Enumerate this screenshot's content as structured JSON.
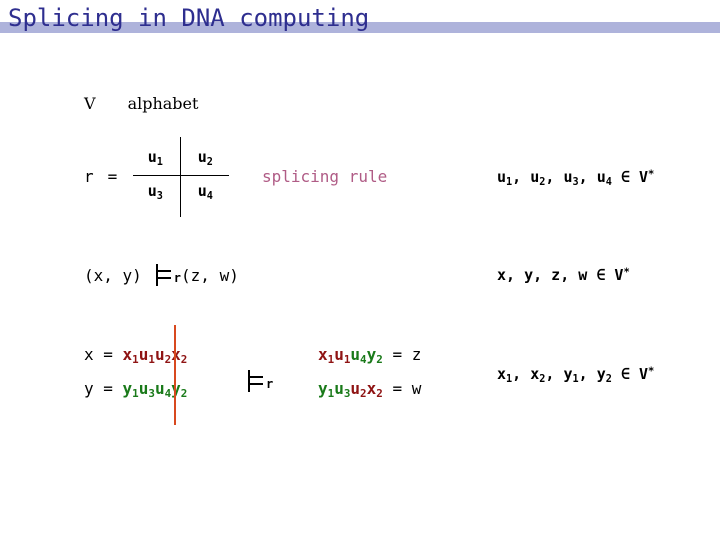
{
  "slide": {
    "title": "Splicing in DNA computing",
    "title_color": "#2e2e8f",
    "bar_color": "#aeb3db"
  },
  "alphabet_row": {
    "symbol": "V",
    "label": "alphabet"
  },
  "rule": {
    "name": "r",
    "equals": "=",
    "cells": {
      "u1": "u",
      "u1_sub": "1",
      "u2": "u",
      "u2_sub": "2",
      "u3": "u",
      "u3_sub": "3",
      "u4": "u",
      "u4_sub": "4"
    },
    "caption": "splicing rule",
    "caption_color": "#b05c86"
  },
  "notes": {
    "u_membership": {
      "text": "u",
      "s1": "1",
      "t2": ", u",
      "s2": "2",
      "t3": ", u",
      "s3": "3",
      "t4": ", u",
      "s4": "4",
      "tail": " ∈ V",
      "star": "*"
    },
    "xyzw_membership": {
      "text": "x, y, z, w ∈ V",
      "star": "*"
    },
    "x12_membership": {
      "lead": "x",
      "s1": "1",
      "p2": ", x",
      "s2": "2",
      "p3": ", y",
      "s3": "1",
      "p4": ", y",
      "s4": "2",
      "tail": " ∈ V",
      "star": "*"
    }
  },
  "derivation": {
    "left_pair": "(x, y)",
    "turnstile_sub": "r",
    "right_pair": "(z, w)"
  },
  "bottom": {
    "x_line": {
      "lhs": "x  =  ",
      "seg1": "x",
      "seg1_sub": "1",
      "seg2": "u",
      "seg2_sub": "1",
      "seg3": "u",
      "seg3_sub": "2",
      "seg4": "x",
      "seg4_sub": "2"
    },
    "y_line": {
      "lhs": "y  =  ",
      "seg1": "y",
      "seg1_sub": "1",
      "seg2": "u",
      "seg2_sub": "3",
      "seg3": "u",
      "seg3_sub": "4",
      "seg4": "y",
      "seg4_sub": "2"
    },
    "turnstile_sub": "r",
    "z_line": {
      "seg1": "x",
      "seg1_sub": "1",
      "seg2": "u",
      "seg2_sub": "1",
      "seg3": "u",
      "seg3_sub": "4",
      "seg4": "y",
      "seg4_sub": "2",
      "rhs": "  =  z"
    },
    "w_line": {
      "seg1": "y",
      "seg1_sub": "1",
      "seg2": "u",
      "seg2_sub": "3",
      "seg3": "u",
      "seg3_sub": "2",
      "seg4": "x",
      "seg4_sub": "2",
      "rhs": "  =  w"
    },
    "cut_line_color": "#d8491f",
    "red_color": "#8f1414",
    "green_color": "#1a7a1a"
  }
}
